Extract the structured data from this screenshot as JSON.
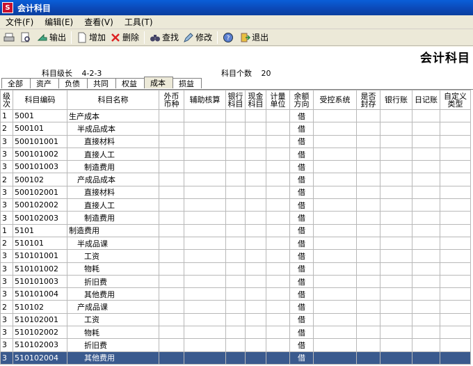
{
  "window": {
    "title": "会计科目",
    "icon_text": "S"
  },
  "menu": [
    "文件(F)",
    "编辑(E)",
    "查看(V)",
    "工具(T)"
  ],
  "toolbar": {
    "output": "输出",
    "add": "增加",
    "delete": "删除",
    "find": "查找",
    "modify": "修改",
    "exit": "退出"
  },
  "header": {
    "title": "会计科目",
    "code_length_label": "科目级长",
    "code_length_value": "4-2-3",
    "count_label": "科目个数",
    "count_value": "20"
  },
  "tabs": [
    "全部",
    "资产",
    "负债",
    "共同",
    "权益",
    "成本",
    "损益"
  ],
  "active_tab": "成本",
  "columns": [
    "级次",
    "科目编码",
    "科目名称",
    "外币币种",
    "辅助核算",
    "银行科目",
    "现金科目",
    "计量单位",
    "余额方向",
    "受控系统",
    "是否封存",
    "银行账",
    "日记账",
    "自定义类型"
  ],
  "rows": [
    {
      "level": "1",
      "code": "5001",
      "name": "生产成本",
      "dir": "借"
    },
    {
      "level": "2",
      "code": "500101",
      "name": "半成品成本",
      "dir": "借"
    },
    {
      "level": "3",
      "code": "500101001",
      "name": "直接材料",
      "dir": "借"
    },
    {
      "level": "3",
      "code": "500101002",
      "name": "直接人工",
      "dir": "借"
    },
    {
      "level": "3",
      "code": "500101003",
      "name": "制造费用",
      "dir": "借"
    },
    {
      "level": "2",
      "code": "500102",
      "name": "产成品成本",
      "dir": "借"
    },
    {
      "level": "3",
      "code": "500102001",
      "name": "直接材料",
      "dir": "借"
    },
    {
      "level": "3",
      "code": "500102002",
      "name": "直接人工",
      "dir": "借"
    },
    {
      "level": "3",
      "code": "500102003",
      "name": "制造费用",
      "dir": "借"
    },
    {
      "level": "1",
      "code": "5101",
      "name": "制造费用",
      "dir": "借"
    },
    {
      "level": "2",
      "code": "510101",
      "name": "半成品课",
      "dir": "借"
    },
    {
      "level": "3",
      "code": "510101001",
      "name": "工资",
      "dir": "借"
    },
    {
      "level": "3",
      "code": "510101002",
      "name": "物耗",
      "dir": "借"
    },
    {
      "level": "3",
      "code": "510101003",
      "name": "折旧费",
      "dir": "借"
    },
    {
      "level": "3",
      "code": "510101004",
      "name": "其他费用",
      "dir": "借"
    },
    {
      "level": "2",
      "code": "510102",
      "name": "产成品课",
      "dir": "借"
    },
    {
      "level": "3",
      "code": "510102001",
      "name": "工资",
      "dir": "借"
    },
    {
      "level": "3",
      "code": "510102002",
      "name": "物耗",
      "dir": "借"
    },
    {
      "level": "3",
      "code": "510102003",
      "name": "折旧费",
      "dir": "借"
    },
    {
      "level": "3",
      "code": "510102004",
      "name": "其他费用",
      "dir": "借"
    }
  ],
  "selected_row": 19,
  "colors": {
    "titlebar": "#0b49b8",
    "selection": "#3a5a8e",
    "toolbar_bg": "#ece9d8"
  }
}
